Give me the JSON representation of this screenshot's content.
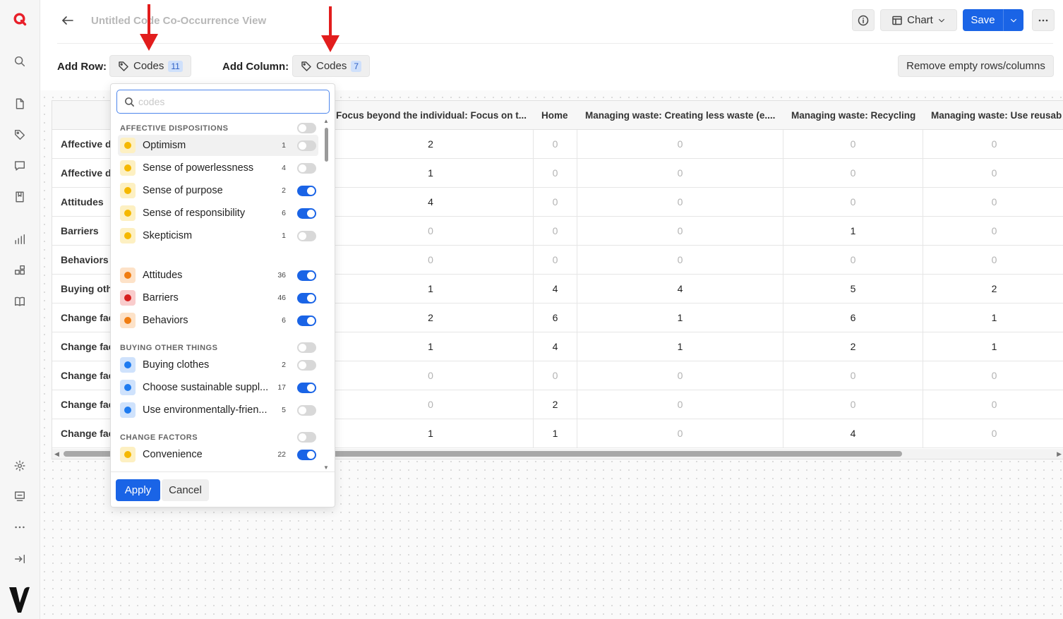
{
  "app": {
    "title": "Untitled Code Co-Occurrence View",
    "accent": "#1a64e6"
  },
  "toolbar": {
    "chart_label": "Chart",
    "save_label": "Save",
    "add_row_label": "Add Row:",
    "add_column_label": "Add Column:",
    "row_codes_label": "Codes",
    "row_codes_count": "11",
    "col_codes_label": "Codes",
    "col_codes_count": "7",
    "remove_empty_label": "Remove empty rows/columns"
  },
  "icons": {
    "rail": [
      "logo-icon",
      "search-icon",
      "document-icon",
      "tag-icon",
      "comment-icon",
      "bookmark-icon",
      "bar-chart-icon",
      "workflow-icon",
      "book-icon",
      "gear-icon",
      "feedback-icon",
      "more-icon",
      "collapse-icon",
      "brand-logo-icon"
    ]
  },
  "table": {
    "columns": [
      "Focus beyond the individual: Focus on t...",
      "Home",
      "Managing waste: Creating less waste (e....",
      "Managing waste: Recycling",
      "Managing waste: Use reusab"
    ],
    "rows": [
      {
        "label": "Affective d",
        "cells": [
          "2",
          "0",
          "0",
          "0",
          "0"
        ]
      },
      {
        "label": "Affective d",
        "cells": [
          "1",
          "0",
          "0",
          "0",
          "0"
        ]
      },
      {
        "label": "Attitudes",
        "cells": [
          "4",
          "0",
          "0",
          "0",
          "0"
        ]
      },
      {
        "label": "Barriers",
        "cells": [
          "0",
          "0",
          "0",
          "1",
          "0"
        ]
      },
      {
        "label": "Behaviors",
        "cells": [
          "0",
          "0",
          "0",
          "0",
          "0"
        ]
      },
      {
        "label": "Buying oth",
        "cells": [
          "1",
          "4",
          "4",
          "5",
          "2"
        ]
      },
      {
        "label": "Change fac",
        "cells": [
          "2",
          "6",
          "1",
          "6",
          "1"
        ]
      },
      {
        "label": "Change fac",
        "cells": [
          "1",
          "4",
          "1",
          "2",
          "1"
        ]
      },
      {
        "label": "Change fac",
        "cells": [
          "0",
          "0",
          "0",
          "0",
          "0"
        ]
      },
      {
        "label": "Change fac",
        "cells": [
          "0",
          "2",
          "0",
          "0",
          "0"
        ]
      },
      {
        "label": "Change fac",
        "cells": [
          "1",
          "1",
          "0",
          "4",
          "0"
        ]
      }
    ]
  },
  "dropdown": {
    "search_placeholder": "codes",
    "groups": [
      {
        "name": "AFFECTIVE DISPOSITIONS",
        "toggle": false,
        "items": [
          {
            "name": "Optimism",
            "count": "1",
            "on": false,
            "color": "#f5b800",
            "bg": "#fdf0c2"
          },
          {
            "name": "Sense of powerlessness",
            "count": "4",
            "on": false,
            "color": "#f5b800",
            "bg": "#fdf0c2"
          },
          {
            "name": "Sense of purpose",
            "count": "2",
            "on": true,
            "color": "#f5b800",
            "bg": "#fdf0c2"
          },
          {
            "name": "Sense of responsibility",
            "count": "6",
            "on": true,
            "color": "#f5b800",
            "bg": "#fdf0c2"
          },
          {
            "name": "Skepticism",
            "count": "1",
            "on": false,
            "color": "#f5b800",
            "bg": "#fdf0c2"
          }
        ]
      },
      {
        "name": "",
        "toggle": null,
        "items": [
          {
            "name": "Attitudes",
            "count": "36",
            "on": true,
            "color": "#f07d12",
            "bg": "#fde2c8"
          },
          {
            "name": "Barriers",
            "count": "46",
            "on": true,
            "color": "#d71f1f",
            "bg": "#f9cccc"
          },
          {
            "name": "Behaviors",
            "count": "6",
            "on": true,
            "color": "#f07d12",
            "bg": "#fde2c8"
          }
        ]
      },
      {
        "name": "BUYING OTHER THINGS",
        "toggle": false,
        "items": [
          {
            "name": "Buying clothes",
            "count": "2",
            "on": false,
            "color": "#1e7bf0",
            "bg": "#cfe2fc"
          },
          {
            "name": "Choose sustainable suppl...",
            "count": "17",
            "on": true,
            "color": "#1e7bf0",
            "bg": "#cfe2fc"
          },
          {
            "name": "Use environmentally-frien...",
            "count": "5",
            "on": false,
            "color": "#1e7bf0",
            "bg": "#cfe2fc"
          }
        ]
      },
      {
        "name": "CHANGE FACTORS",
        "toggle": false,
        "items": [
          {
            "name": "Convenience",
            "count": "22",
            "on": true,
            "color": "#f5b800",
            "bg": "#fdf0c2"
          }
        ]
      }
    ],
    "apply_label": "Apply",
    "cancel_label": "Cancel"
  }
}
